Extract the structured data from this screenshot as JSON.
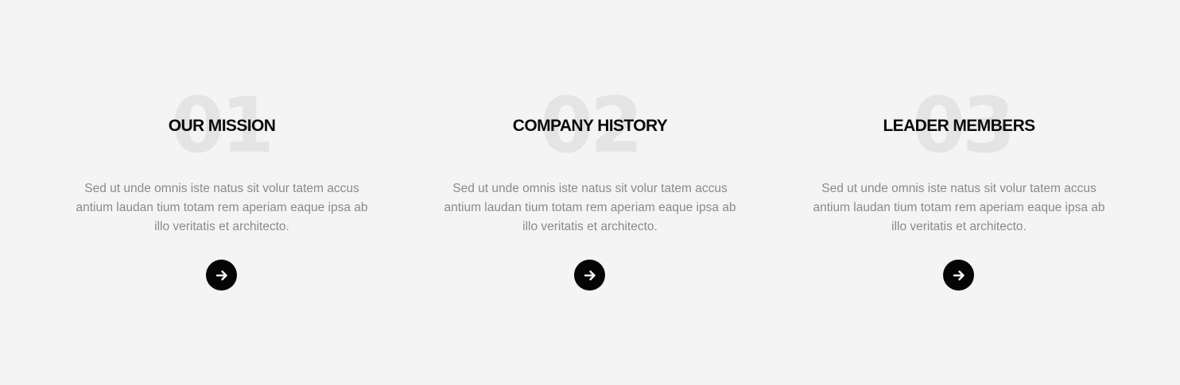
{
  "features": [
    {
      "number": "01",
      "title": "OUR MISSION",
      "description": "Sed ut unde omnis iste natus sit volur tatem accus antium laudan tium totam rem aperiam eaque ipsa ab illo veritatis et architecto.",
      "button_icon": "arrow-right-icon"
    },
    {
      "number": "02",
      "title": "COMPANY HISTORY",
      "description": "Sed ut unde omnis iste natus sit volur tatem accus antium laudan tium totam rem aperiam eaque ipsa ab illo veritatis et architecto.",
      "button_icon": "arrow-right-icon"
    },
    {
      "number": "03",
      "title": "LEADER MEMBERS",
      "description": "Sed ut unde omnis iste natus sit volur tatem accus antium laudan tium totam rem aperiam eaque ipsa ab illo veritatis et architecto.",
      "button_icon": "arrow-right-icon"
    }
  ],
  "colors": {
    "background": "#f4f4f4",
    "number_watermark": "#e4e4e4",
    "title": "#0b0b0b",
    "description": "#8a8a8a",
    "button": "#050505",
    "button_icon": "#ffffff"
  }
}
